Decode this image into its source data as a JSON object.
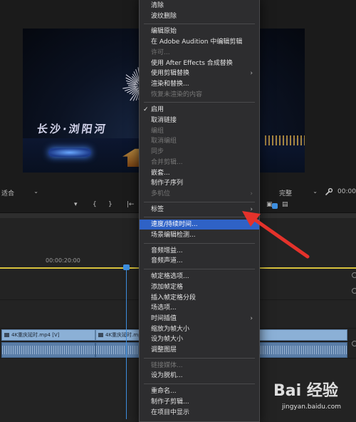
{
  "menu": {
    "items": [
      {
        "label": "清除",
        "disabled": false
      },
      {
        "label": "波纹删除",
        "disabled": false
      },
      {
        "sep": true
      },
      {
        "label": "编辑原始",
        "disabled": false
      },
      {
        "label": "在 Adobe Audition 中编辑剪辑",
        "disabled": false
      },
      {
        "label": "许可...",
        "disabled": true
      },
      {
        "label": "使用 After Effects 合成替换",
        "disabled": false
      },
      {
        "label": "使用剪辑替换",
        "disabled": false,
        "submenu": true
      },
      {
        "label": "渲染和替换...",
        "disabled": false
      },
      {
        "label": "恢复未渲染的内容",
        "disabled": true
      },
      {
        "sep": true
      },
      {
        "label": "启用",
        "disabled": false,
        "checked": true
      },
      {
        "label": "取消链接",
        "disabled": false
      },
      {
        "label": "编组",
        "disabled": true
      },
      {
        "label": "取消编组",
        "disabled": true
      },
      {
        "label": "同步",
        "disabled": true
      },
      {
        "label": "合并剪辑...",
        "disabled": true
      },
      {
        "label": "嵌套...",
        "disabled": false
      },
      {
        "label": "制作子序列",
        "disabled": false
      },
      {
        "label": "多机位",
        "disabled": true,
        "submenu": true
      },
      {
        "sep": true
      },
      {
        "label": "标签",
        "disabled": false,
        "submenu": true
      },
      {
        "sep": true
      },
      {
        "label": "速度/持续时间...",
        "disabled": false,
        "highlighted": true
      },
      {
        "label": "场景编辑检测...",
        "disabled": false
      },
      {
        "sep": true
      },
      {
        "label": "音频增益...",
        "disabled": false
      },
      {
        "label": "音频声道...",
        "disabled": false
      },
      {
        "sep": true
      },
      {
        "label": "帧定格选项...",
        "disabled": false
      },
      {
        "label": "添加帧定格",
        "disabled": false
      },
      {
        "label": "插入帧定格分段",
        "disabled": false
      },
      {
        "label": "场选项...",
        "disabled": false
      },
      {
        "label": "时间插值",
        "disabled": false,
        "submenu": true
      },
      {
        "label": "缩放为帧大小",
        "disabled": false
      },
      {
        "label": "设为帧大小",
        "disabled": false
      },
      {
        "label": "调整图层",
        "disabled": false
      },
      {
        "sep": true
      },
      {
        "label": "链接媒体...",
        "disabled": true
      },
      {
        "label": "设为脱机...",
        "disabled": false
      },
      {
        "sep": true
      },
      {
        "label": "重命名...",
        "disabled": false
      },
      {
        "label": "制作子剪辑...",
        "disabled": false
      },
      {
        "label": "在项目中显示",
        "disabled": false
      }
    ]
  },
  "monitor": {
    "fit_label": "适合",
    "quality_label": "完整",
    "timecode": "00:00"
  },
  "video": {
    "overlay_text": "长沙·浏阳河"
  },
  "timeline": {
    "ruler_time": "00:00:20:00",
    "clips": [
      {
        "label": "4K重庆延时.mp4 [V]"
      },
      {
        "label": "4K重庆延时.mp4 [V]"
      }
    ]
  },
  "icons": {
    "wrench": "wrench-icon",
    "arrow": "red-arrow-annotation",
    "submenu": "chevron-right-icon",
    "check": "checkmark-icon"
  },
  "colors": {
    "menu_bg": "#2d2d2f",
    "highlight": "#2f62c6",
    "playhead": "#3e8fe0",
    "annotation_arrow": "#e4322b",
    "work_area": "#d8c23c"
  },
  "watermark": {
    "logo": "Bai 经验",
    "url": "jingyan.baidu.com"
  }
}
